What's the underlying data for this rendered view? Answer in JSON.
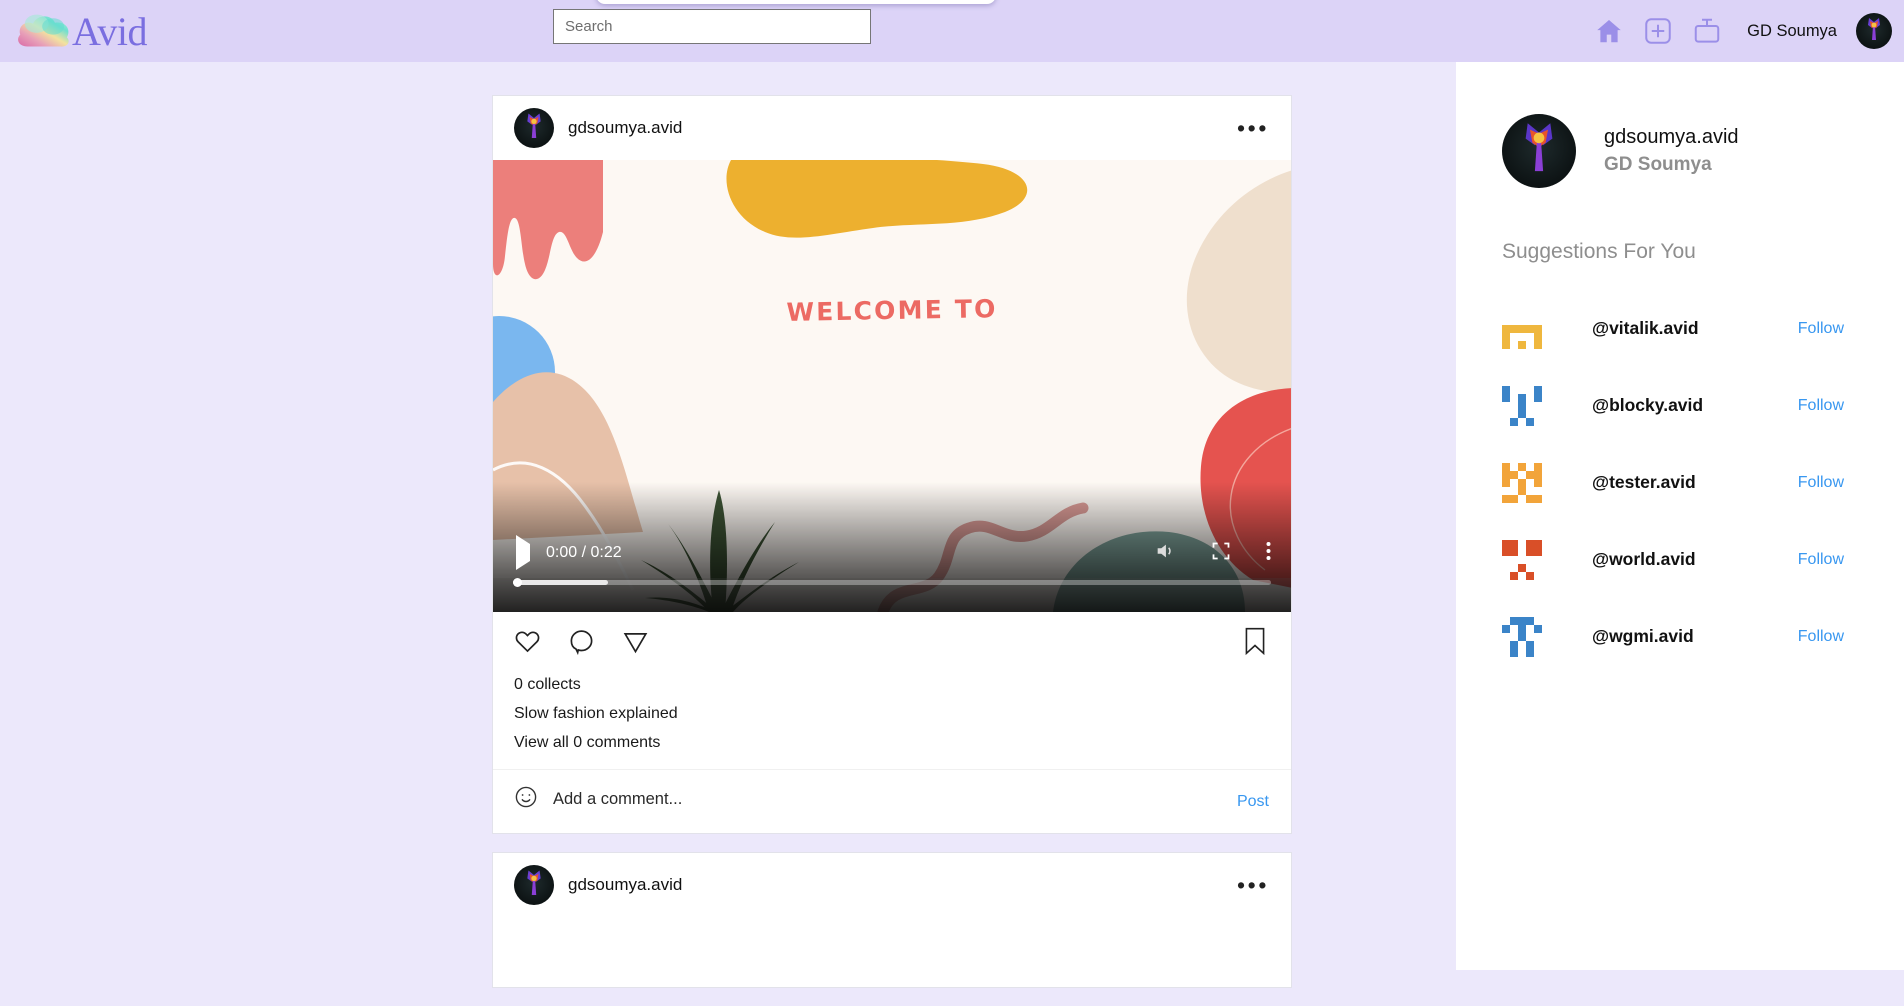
{
  "brand": {
    "name": "Avid",
    "logo_icon": "cloud-logo",
    "accent": "#7a6ee0"
  },
  "header": {
    "search": {
      "placeholder": "Search",
      "value": ""
    },
    "icons": [
      {
        "name": "home-icon",
        "label": "Home"
      },
      {
        "name": "plus-square-icon",
        "label": "Create"
      },
      {
        "name": "tv-icon",
        "label": "Watch"
      }
    ],
    "user_name": "GD Soumya",
    "avatar_icon": "user-avatar"
  },
  "feed": {
    "posts": [
      {
        "username": "gdsoumya.avid",
        "menu_icon": "more-options-icon",
        "video": {
          "play_icon": "play-icon",
          "time": "0:00 / 0:22",
          "current_time": "0:00",
          "duration": "0:22",
          "volume_icon": "volume-icon",
          "fullscreen_icon": "fullscreen-icon",
          "more_icon": "video-more-icon",
          "overlay_text": "WELCOME TO",
          "progress_percent": 12.5
        },
        "actions": {
          "like_icon": "heart-icon",
          "comment_icon": "comment-icon",
          "share_icon": "share-icon",
          "save_icon": "bookmark-icon"
        },
        "collects": "0 collects",
        "caption": "Slow fashion explained",
        "view_comments": "View all 0 comments",
        "comment_box": {
          "emoji_icon": "emoji-icon",
          "placeholder": "Add a comment...",
          "value": "",
          "post_label": "Post"
        }
      },
      {
        "username": "gdsoumya.avid",
        "menu_icon": "more-options-icon"
      }
    ]
  },
  "sidebar": {
    "profile": {
      "username": "gdsoumya.avid",
      "display_name": "GD Soumya",
      "avatar_icon": "user-avatar"
    },
    "suggestions_title": "Suggestions For You",
    "follow_label": "Follow",
    "suggestions": [
      {
        "username": "@vitalik.avid",
        "avatar_icon": "identicon",
        "color": "#efb73e",
        "cells": "0000001111001010011110000000"
      },
      {
        "username": "@blocky.avid",
        "avatar_icon": "identicon",
        "color": "#3b84c8",
        "cells": "1001010010010100101001001010"
      },
      {
        "username": "@tester.avid",
        "avatar_icon": "identicon",
        "color": "#f2a43a",
        "cells": "1011101010011101010110111000"
      },
      {
        "username": "@world.avid",
        "avatar_icon": "identicon",
        "color": "#d94f28",
        "cells": "1101100000010101101100010000"
      },
      {
        "username": "@wgmi.avid",
        "avatar_icon": "identicon",
        "color": "#3b84c8",
        "cells": "0111010010100101001010010100"
      }
    ]
  },
  "colors": {
    "page_bg": "#ece8fb",
    "header_bg": "#dcd3f7",
    "link_blue": "#3897f0",
    "muted_gray": "#8e8e8e",
    "video_coral": "#ec7f7b",
    "video_yellow": "#edb02f",
    "video_blue": "#7ab7ef",
    "video_tan": "#e7c1a9",
    "video_beige": "#efdfcd",
    "video_red": "#e5534f",
    "video_teal": "#7fa39b",
    "video_green": "#3c5234",
    "video_bg": "#fdf8f3"
  }
}
